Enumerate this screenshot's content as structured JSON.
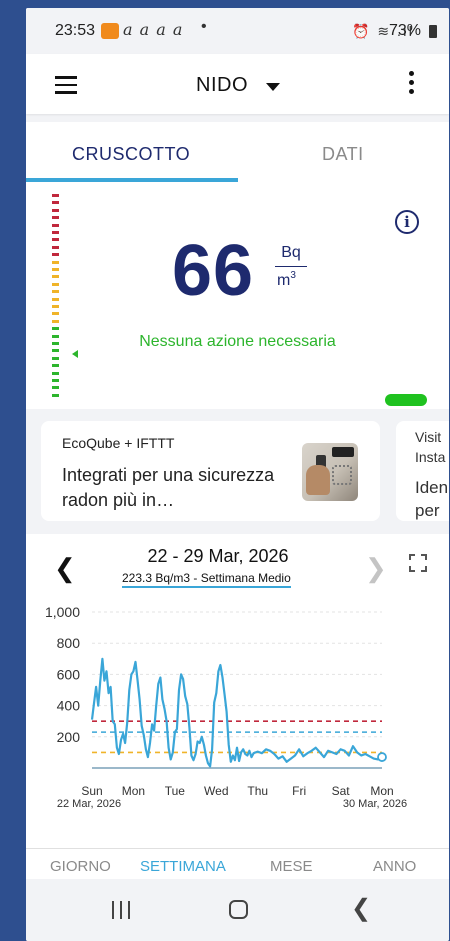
{
  "status_bar": {
    "time": "23:53",
    "notification_glyphs": "a a a a",
    "dot": "•",
    "icons": "⏰ ≋ .ıl",
    "battery": "73%"
  },
  "toolbar": {
    "title": "NIDO",
    "menu_icon": "menu-icon",
    "dropdown_icon": "chevron-down-icon",
    "more_icon": "more-vert-icon"
  },
  "tabs": [
    {
      "label": "CRUSCOTTO",
      "active": true
    },
    {
      "label": "DATI",
      "active": false
    }
  ],
  "gauge": {
    "value": "66",
    "unit_numerator": "Bq",
    "unit_denominator": "m",
    "unit_exponent": "3",
    "status": "Nessuna azione necessaria",
    "info_icon": "info-icon",
    "status_color": "#1fc21f"
  },
  "promos": [
    {
      "title": "EcoQube + IFTTT",
      "body": "Integrati per una sicurezza radon più in…",
      "image_icon": "ifttt-product-image"
    },
    {
      "line1": "Visit",
      "line2": "Insta",
      "line3": "Iden",
      "line4": "per"
    }
  ],
  "chart_header": {
    "period": "22 - 29 Mar, 2026",
    "average": "223.3 Bq/m3 - Settimana Medio",
    "prev_icon": "chevron-left-icon",
    "next_icon": "chevron-right-icon",
    "expand_icon": "expand-icon"
  },
  "chart_data": {
    "type": "line",
    "ylim": [
      0,
      1000
    ],
    "y_ticks": [
      "1,000",
      "800",
      "600",
      "400",
      "200"
    ],
    "x_ticks": [
      {
        "label": "Sun",
        "sublabel": "22 Mar, 2026",
        "day": 0
      },
      {
        "label": "Mon",
        "day": 1
      },
      {
        "label": "Tue",
        "day": 2
      },
      {
        "label": "Wed",
        "day": 3
      },
      {
        "label": "Thu",
        "day": 4
      },
      {
        "label": "Fri",
        "day": 5
      },
      {
        "label": "Sat",
        "day": 6
      },
      {
        "label": "Mon",
        "sublabel": "30 Mar, 2026",
        "day": 7
      }
    ],
    "thresholds": [
      {
        "value": 300,
        "color": "#c0283c",
        "style": "dashed"
      },
      {
        "value": 230,
        "color": "#3aa6d8",
        "style": "dashed"
      },
      {
        "value": 100,
        "color": "#f0b429",
        "style": "dashed"
      },
      {
        "value": 0,
        "color": "#7aa0b8",
        "style": "solid"
      }
    ],
    "series": [
      {
        "color": "#3aa6d8",
        "x": [
          0.0,
          0.05,
          0.1,
          0.15,
          0.2,
          0.25,
          0.3,
          0.35,
          0.4,
          0.45,
          0.5,
          0.55,
          0.6,
          0.65,
          0.7,
          0.75,
          0.8,
          0.85,
          0.9,
          0.95,
          1.0,
          1.05,
          1.1,
          1.15,
          1.2,
          1.25,
          1.3,
          1.35,
          1.4,
          1.45,
          1.5,
          1.55,
          1.6,
          1.65,
          1.7,
          1.75,
          1.8,
          1.85,
          1.9,
          1.95,
          2.0,
          2.05,
          2.1,
          2.15,
          2.2,
          2.25,
          2.3,
          2.35,
          2.4,
          2.45,
          2.5,
          2.55,
          2.6,
          2.65,
          2.7,
          2.75,
          2.8,
          2.85,
          2.9,
          2.95,
          3.0,
          3.05,
          3.1,
          3.15,
          3.2,
          3.25,
          3.3,
          3.35,
          3.4,
          3.45,
          3.5,
          3.55,
          3.6,
          3.65,
          3.7,
          3.75,
          3.8,
          3.85,
          3.9,
          3.95,
          4.0,
          4.1,
          4.2,
          4.3,
          4.4,
          4.5,
          4.6,
          4.7,
          4.8,
          4.9,
          5.0,
          5.1,
          5.2,
          5.3,
          5.4,
          5.5,
          5.6,
          5.7,
          5.8,
          5.9,
          6.0,
          6.1,
          6.2,
          6.3,
          6.4,
          6.5,
          6.6,
          6.7,
          6.8,
          6.9,
          7.0
        ],
        "y": [
          310,
          420,
          520,
          400,
          560,
          700,
          560,
          620,
          480,
          520,
          300,
          280,
          130,
          90,
          180,
          220,
          160,
          290,
          500,
          600,
          620,
          680,
          560,
          440,
          270,
          210,
          120,
          70,
          160,
          280,
          240,
          400,
          540,
          580,
          440,
          380,
          300,
          130,
          55,
          100,
          230,
          250,
          500,
          600,
          570,
          460,
          410,
          260,
          80,
          50,
          90,
          170,
          160,
          200,
          150,
          80,
          30,
          10,
          120,
          420,
          480,
          620,
          660,
          580,
          470,
          360,
          150,
          40,
          80,
          50,
          130,
          45,
          100,
          120,
          90,
          80,
          110,
          70,
          95,
          100,
          105,
          95,
          120,
          110,
          90,
          60,
          75,
          40,
          60,
          80,
          120,
          75,
          95,
          110,
          130,
          100,
          70,
          110,
          100,
          90,
          120,
          110,
          80,
          140,
          100,
          80,
          90,
          75,
          60,
          55,
          70
        ]
      }
    ]
  },
  "ranges": [
    {
      "label": "GIORNO",
      "active": false
    },
    {
      "label": "SETTIMANA",
      "active": true
    },
    {
      "label": "MESE",
      "active": false
    },
    {
      "label": "ANNO",
      "active": false
    }
  ],
  "navbar": {
    "recent_icon": "recent-apps-icon",
    "home_icon": "home-icon",
    "back_icon": "back-icon"
  }
}
